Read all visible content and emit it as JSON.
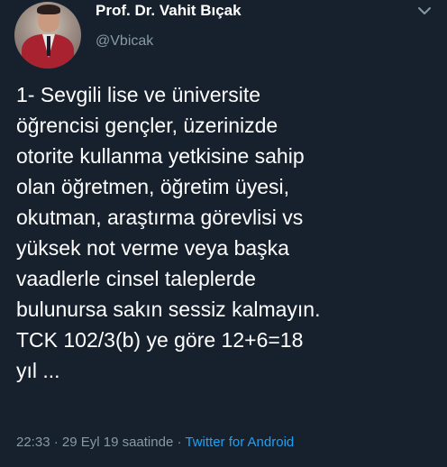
{
  "tweet": {
    "author": {
      "name": "Prof. Dr. Vahit Bıçak",
      "handle": "@Vbicak"
    },
    "menu_icon": "chevron-down-icon",
    "text_lines": [
      "1- Sevgili lise ve üniversite",
      "öğrencisi gençler, üzerinizde",
      "otorite kullanma yetkisine sahip",
      "olan öğretmen, öğretim üyesi,",
      "okutman, araştırma görevlisi vs",
      "yüksek not verme veya başka",
      "vaadlerle cinsel taleplerde",
      "bulunursa sakın sessiz kalmayın.",
      "TCK 102/3(b) ye göre 12+6=18",
      "yıl ..."
    ],
    "meta": {
      "timestamp": "22:33 · 29 Eyl 19 saatinde · ",
      "source": "Twitter for Android"
    }
  },
  "colors": {
    "background": "#17212e",
    "text": "#ffffff",
    "secondary": "#8899a6",
    "link": "#1da1f2"
  }
}
